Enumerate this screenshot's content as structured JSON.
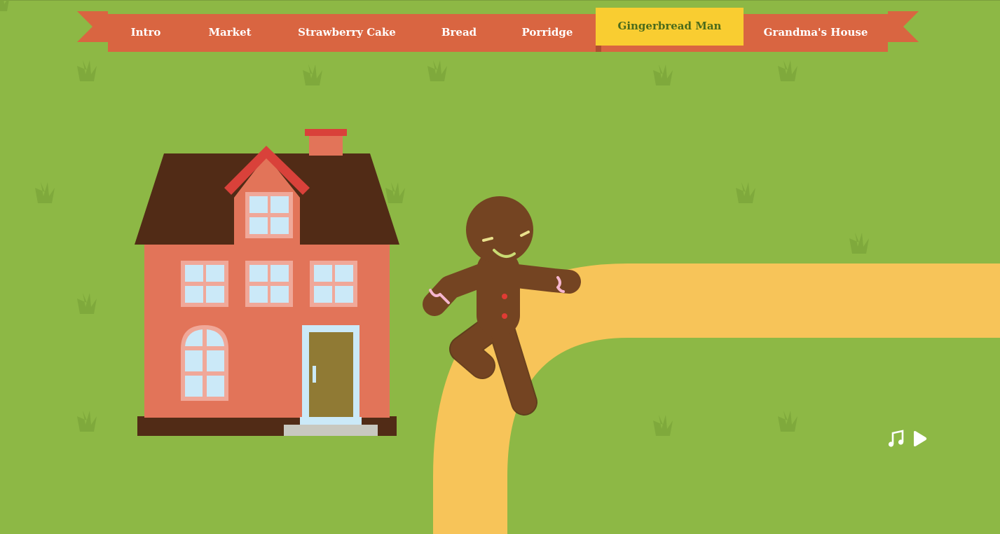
{
  "nav": {
    "items": [
      {
        "label": "Intro",
        "active": false
      },
      {
        "label": "Market",
        "active": false
      },
      {
        "label": "Strawberry Cake",
        "active": false
      },
      {
        "label": "Bread",
        "active": false
      },
      {
        "label": "Porridge",
        "active": false
      },
      {
        "label": "Gingerbread Man",
        "active": true
      },
      {
        "label": "Grandma's House",
        "active": false
      }
    ]
  },
  "controls": {
    "music_icon": "music-note-icon",
    "play_icon": "play-icon"
  },
  "colors": {
    "grass": "#8db845",
    "ribbon": "#d96541",
    "active_tab": "#f9cd31",
    "path": "#f7c459",
    "house_wall": "#e27459",
    "roof": "#512b16",
    "gingerbread": "#744422"
  }
}
